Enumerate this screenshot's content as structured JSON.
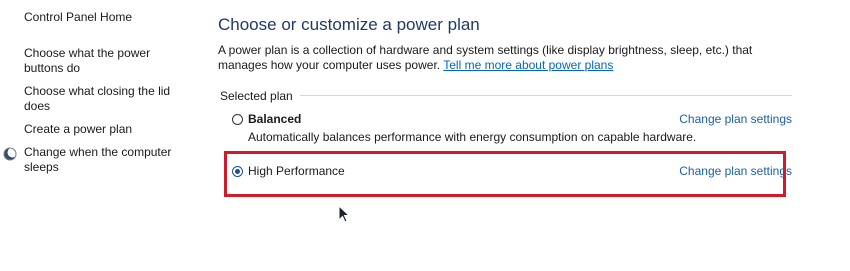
{
  "sidebar": {
    "home_label": "Control Panel Home",
    "links": [
      "Choose what the power buttons do",
      "Choose what closing the lid does",
      "Create a power plan",
      "Change when the computer sleeps"
    ]
  },
  "main": {
    "title": "Choose or customize a power plan",
    "description": "A power plan is a collection of hardware and system settings (like display brightness, sleep, etc.) that manages how your computer uses power.",
    "help_link": "Tell me more about power plans",
    "selected_plan_label": "Selected plan",
    "plans": [
      {
        "name": "Balanced",
        "description": "Automatically balances performance with energy consumption on capable hardware.",
        "selected": false,
        "change_link": "Change plan settings"
      },
      {
        "name": "High Performance",
        "selected": true,
        "change_link": "Change plan settings"
      }
    ]
  },
  "colors": {
    "highlight_border": "#d11a2a",
    "link": "#1a5fa8",
    "title": "#1f3a66"
  },
  "icons": {
    "sleep_icon": "moon-icon",
    "cursor": "mouse-pointer-icon"
  }
}
